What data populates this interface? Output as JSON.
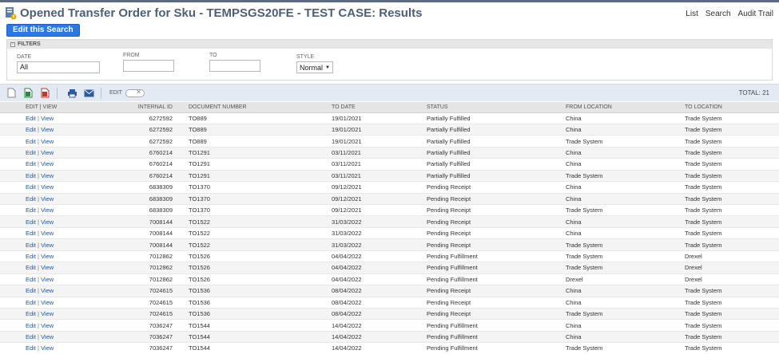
{
  "page": {
    "title": "Opened Transfer Order for Sku - TEMPSGS20FE - TEST CASE: Results",
    "links": [
      "List",
      "Search",
      "Audit Trail"
    ],
    "edit_search_label": "Edit this Search"
  },
  "filters": {
    "heading": "FILTERS",
    "date_label": "DATE",
    "date_value": "All",
    "from_label": "FROM",
    "from_value": "",
    "to_label": "TO",
    "to_value": "",
    "style_label": "STYLE",
    "style_value": "Normal"
  },
  "toolbar": {
    "edit_label": "EDIT",
    "total": "TOTAL: 21"
  },
  "table": {
    "columns": [
      "EDIT | VIEW",
      "INTERNAL ID",
      "DOCUMENT NUMBER",
      "TO DATE",
      "STATUS",
      "FROM LOCATION",
      "TO LOCATION"
    ],
    "edit_label": "Edit",
    "view_label": "View",
    "rows": [
      [
        "6272592",
        "TO889",
        "19/01/2021",
        "Partially Fulfilled",
        "China",
        "Trade System"
      ],
      [
        "6272592",
        "TO889",
        "19/01/2021",
        "Partially Fulfilled",
        "China",
        "Trade System"
      ],
      [
        "6272592",
        "TO889",
        "19/01/2021",
        "Partially Fulfilled",
        "Trade System",
        "Trade System"
      ],
      [
        "6760214",
        "TO1291",
        "03/11/2021",
        "Partially Fulfilled",
        "China",
        "Trade System"
      ],
      [
        "6760214",
        "TO1291",
        "03/11/2021",
        "Partially Fulfilled",
        "China",
        "Trade System"
      ],
      [
        "6760214",
        "TO1291",
        "03/11/2021",
        "Partially Fulfilled",
        "Trade System",
        "Trade System"
      ],
      [
        "6838309",
        "TO1370",
        "09/12/2021",
        "Pending Receipt",
        "China",
        "Trade System"
      ],
      [
        "6838309",
        "TO1370",
        "09/12/2021",
        "Pending Receipt",
        "China",
        "Trade System"
      ],
      [
        "6838309",
        "TO1370",
        "09/12/2021",
        "Pending Receipt",
        "Trade System",
        "Trade System"
      ],
      [
        "7008144",
        "TO1522",
        "31/03/2022",
        "Pending Receipt",
        "China",
        "Trade System"
      ],
      [
        "7008144",
        "TO1522",
        "31/03/2022",
        "Pending Receipt",
        "China",
        "Trade System"
      ],
      [
        "7008144",
        "TO1522",
        "31/03/2022",
        "Pending Receipt",
        "Trade System",
        "Trade System"
      ],
      [
        "7012862",
        "TO1526",
        "04/04/2022",
        "Pending Fulfillment",
        "Trade System",
        "Drexel"
      ],
      [
        "7012862",
        "TO1526",
        "04/04/2022",
        "Pending Fulfillment",
        "Trade System",
        "Drexel"
      ],
      [
        "7012862",
        "TO1526",
        "04/04/2022",
        "Pending Fulfillment",
        "Drexel",
        "Drexel"
      ],
      [
        "7024615",
        "TO1536",
        "08/04/2022",
        "Pending Receipt",
        "China",
        "Trade System"
      ],
      [
        "7024615",
        "TO1536",
        "08/04/2022",
        "Pending Receipt",
        "China",
        "Trade System"
      ],
      [
        "7024615",
        "TO1536",
        "08/04/2022",
        "Pending Receipt",
        "Trade System",
        "Trade System"
      ],
      [
        "7036247",
        "TO1544",
        "14/04/2022",
        "Pending Fulfillment",
        "China",
        "Trade System"
      ],
      [
        "7036247",
        "TO1544",
        "14/04/2022",
        "Pending Fulfillment",
        "China",
        "Trade System"
      ],
      [
        "7036247",
        "TO1544",
        "14/04/2022",
        "Pending Fulfillment",
        "Trade System",
        "Trade System"
      ]
    ]
  },
  "colors": {
    "accent": "#2b78e4",
    "title": "#4d5f79",
    "link": "#255599"
  }
}
